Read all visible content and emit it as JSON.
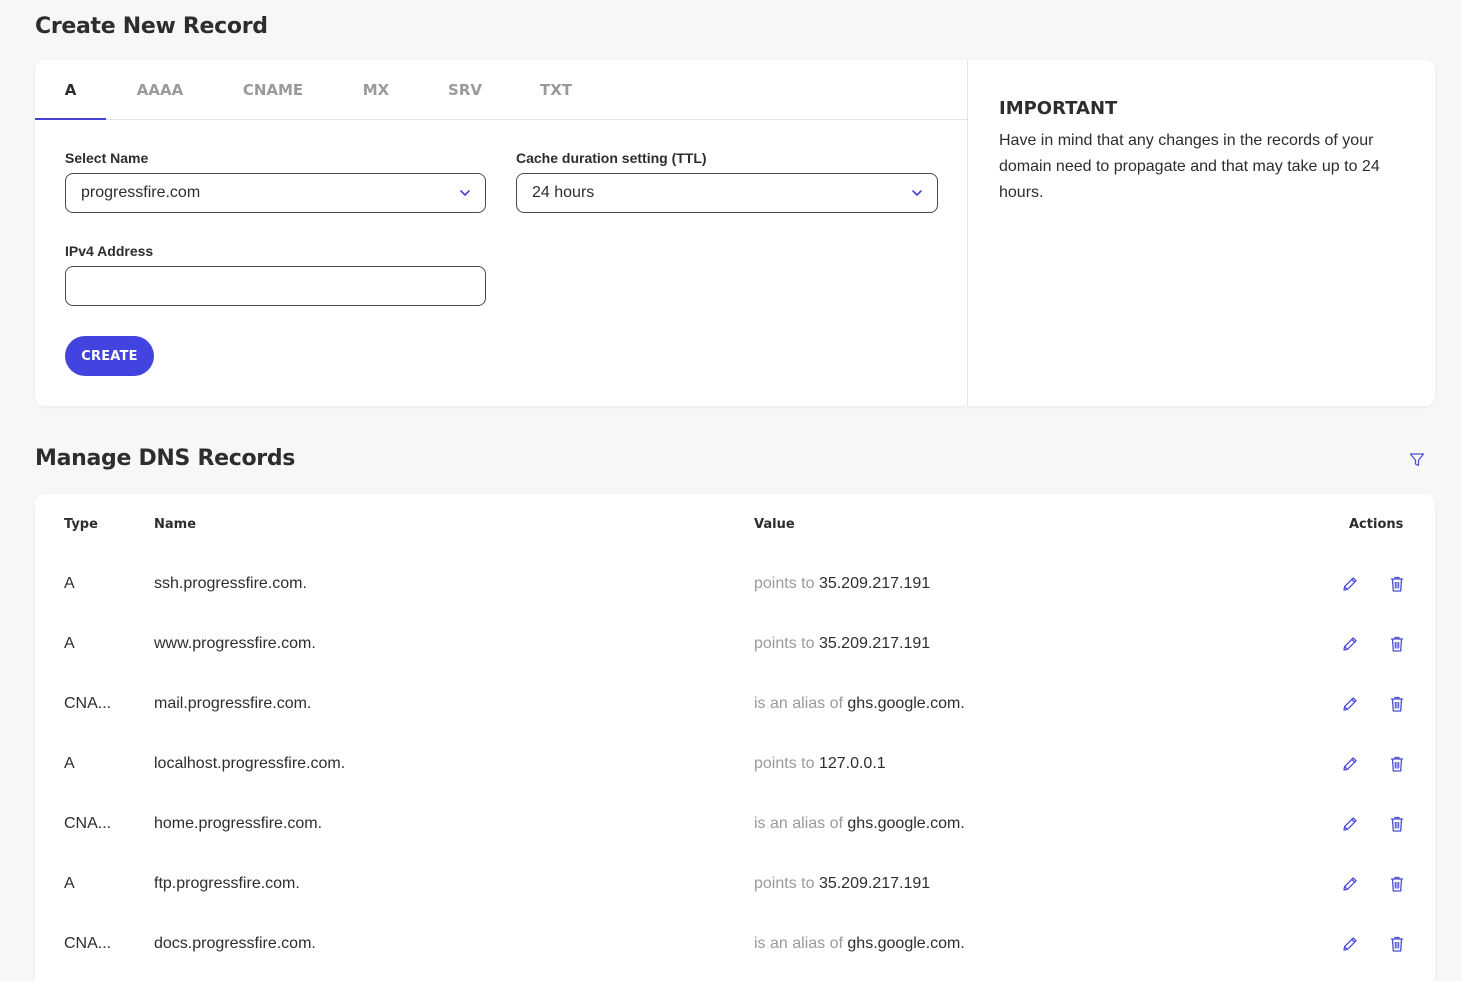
{
  "create": {
    "title": "Create New Record",
    "tabs": [
      {
        "label": "A"
      },
      {
        "label": "AAAA"
      },
      {
        "label": "CNAME"
      },
      {
        "label": "MX"
      },
      {
        "label": "SRV"
      },
      {
        "label": "TXT"
      }
    ],
    "active_tab": "A",
    "select_name": {
      "label": "Select Name",
      "value": "progressfire.com"
    },
    "ttl": {
      "label": "Cache duration setting (TTL)",
      "value": "24 hours"
    },
    "ipv4": {
      "label": "IPv4 Address",
      "value": "",
      "placeholder": ""
    },
    "create_button": "CREATE",
    "info": {
      "title": "IMPORTANT",
      "text": "Have in mind that any changes in the records of your domain need to propagate and that may take up to 24 hours."
    }
  },
  "manage": {
    "title": "Manage DNS Records",
    "columns": {
      "type": "Type",
      "name": "Name",
      "value": "Value",
      "actions": "Actions"
    },
    "records": [
      {
        "type": "A",
        "name": "ssh.progressfire.com.",
        "relation": "points to",
        "target": "35.209.217.191"
      },
      {
        "type": "A",
        "name": "www.progressfire.com.",
        "relation": "points to",
        "target": "35.209.217.191"
      },
      {
        "type": "CNA...",
        "name": "mail.progressfire.com.",
        "relation": "is an alias of",
        "target": "ghs.google.com."
      },
      {
        "type": "A",
        "name": "localhost.progressfire.com.",
        "relation": "points to",
        "target": "127.0.0.1"
      },
      {
        "type": "CNA...",
        "name": "home.progressfire.com.",
        "relation": "is an alias of",
        "target": "ghs.google.com."
      },
      {
        "type": "A",
        "name": "ftp.progressfire.com.",
        "relation": "points to",
        "target": "35.209.217.191"
      },
      {
        "type": "CNA...",
        "name": "docs.progressfire.com.",
        "relation": "is an alias of",
        "target": "ghs.google.com."
      }
    ]
  },
  "colors": {
    "accent": "#4343e0",
    "icon": "#4b4bd1",
    "muted": "#9a9a9a"
  }
}
